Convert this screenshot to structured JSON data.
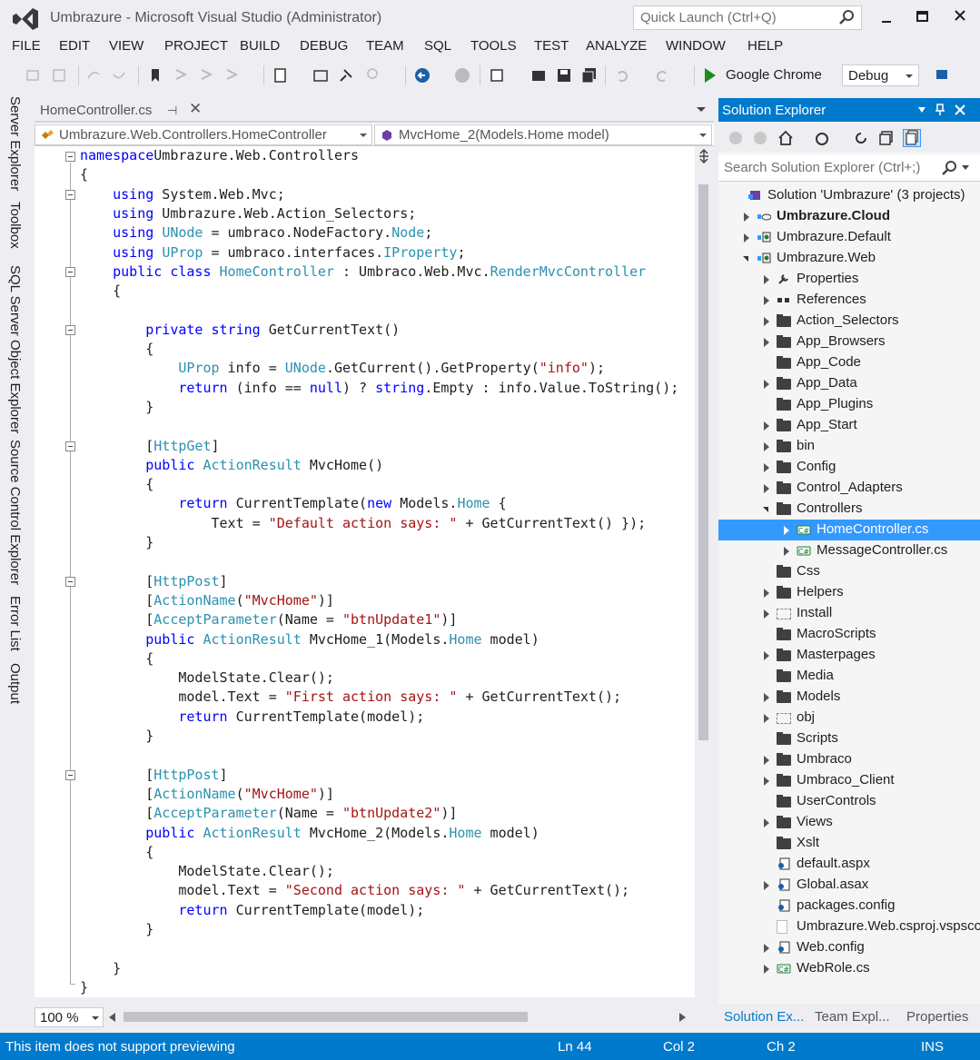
{
  "window": {
    "title": "Umbrazure - Microsoft Visual Studio (Administrator)",
    "quick_launch_placeholder": "Quick Launch (Ctrl+Q)"
  },
  "menu": [
    "FILE",
    "EDIT",
    "VIEW",
    "PROJECT",
    "BUILD",
    "DEBUG",
    "TEAM",
    "SQL",
    "TOOLS",
    "TEST",
    "ANALYZE",
    "WINDOW",
    "HELP"
  ],
  "toolbar": {
    "run_target": "Google Chrome",
    "configuration": "Debug"
  },
  "side_tabs": [
    "Server Explorer",
    "Toolbox",
    "SQL Server Object Explorer",
    "Source Control Explorer",
    "Error List",
    "Output"
  ],
  "document": {
    "tab_label": "HomeController.cs",
    "pin_glyph": "⊣",
    "close_glyph": "✕",
    "nav_type": "Umbrazure.Web.Controllers.HomeController",
    "nav_member": "MvcHome_2(Models.Home model)"
  },
  "code": [
    [
      [
        "kw",
        "namespace"
      ],
      [
        "",
        "Umbrazure.Web.Controllers"
      ]
    ],
    [
      [
        "",
        "{"
      ]
    ],
    [
      [
        "",
        "    "
      ],
      [
        "kw",
        "using"
      ],
      [
        "",
        " System.Web.Mvc;"
      ]
    ],
    [
      [
        "",
        "    "
      ],
      [
        "kw",
        "using"
      ],
      [
        "",
        " Umbrazure.Web.Action_Selectors;"
      ]
    ],
    [
      [
        "",
        "    "
      ],
      [
        "kw",
        "using"
      ],
      [
        "",
        " "
      ],
      [
        "ty",
        "UNode"
      ],
      [
        "",
        " = umbraco.NodeFactory."
      ],
      [
        "ty",
        "Node"
      ],
      [
        "",
        ";"
      ]
    ],
    [
      [
        "",
        "    "
      ],
      [
        "kw",
        "using"
      ],
      [
        "",
        " "
      ],
      [
        "ty",
        "UProp"
      ],
      [
        "",
        " = umbraco.interfaces."
      ],
      [
        "ty",
        "IProperty"
      ],
      [
        "",
        ";"
      ]
    ],
    [
      [
        "",
        "    "
      ],
      [
        "kw",
        "public"
      ],
      [
        "",
        " "
      ],
      [
        "kw",
        "class"
      ],
      [
        "",
        " "
      ],
      [
        "ty",
        "HomeController"
      ],
      [
        "",
        " : Umbraco.Web.Mvc."
      ],
      [
        "ty",
        "RenderMvcController"
      ]
    ],
    [
      [
        "",
        "    {"
      ]
    ],
    [
      [
        "",
        ""
      ]
    ],
    [
      [
        "",
        "        "
      ],
      [
        "kw",
        "private"
      ],
      [
        "",
        " "
      ],
      [
        "kw",
        "string"
      ],
      [
        "",
        " GetCurrentText()"
      ]
    ],
    [
      [
        "",
        "        {"
      ]
    ],
    [
      [
        "",
        "            "
      ],
      [
        "ty",
        "UProp"
      ],
      [
        "",
        " info = "
      ],
      [
        "ty",
        "UNode"
      ],
      [
        "",
        ".GetCurrent().GetProperty("
      ],
      [
        "st",
        "\"info\""
      ],
      [
        "",
        ");"
      ]
    ],
    [
      [
        "",
        "            "
      ],
      [
        "kw",
        "return"
      ],
      [
        "",
        " (info == "
      ],
      [
        "kw",
        "null"
      ],
      [
        "",
        ") ? "
      ],
      [
        "kw",
        "string"
      ],
      [
        "",
        ".Empty : info.Value.ToString();"
      ]
    ],
    [
      [
        "",
        "        }"
      ]
    ],
    [
      [
        "",
        ""
      ]
    ],
    [
      [
        "",
        "        ["
      ],
      [
        "ty",
        "HttpGet"
      ],
      [
        "",
        "]"
      ]
    ],
    [
      [
        "",
        "        "
      ],
      [
        "kw",
        "public"
      ],
      [
        "",
        " "
      ],
      [
        "ty",
        "ActionResult"
      ],
      [
        "",
        " MvcHome()"
      ]
    ],
    [
      [
        "",
        "        {"
      ]
    ],
    [
      [
        "",
        "            "
      ],
      [
        "kw",
        "return"
      ],
      [
        "",
        " CurrentTemplate("
      ],
      [
        "kw",
        "new"
      ],
      [
        "",
        " Models."
      ],
      [
        "ty",
        "Home"
      ],
      [
        "",
        " {"
      ]
    ],
    [
      [
        "",
        "                Text = "
      ],
      [
        "st",
        "\"Default action says: \""
      ],
      [
        "",
        " + GetCurrentText() });"
      ]
    ],
    [
      [
        "",
        "        }"
      ]
    ],
    [
      [
        "",
        ""
      ]
    ],
    [
      [
        "",
        "        ["
      ],
      [
        "ty",
        "HttpPost"
      ],
      [
        "",
        "]"
      ]
    ],
    [
      [
        "",
        "        ["
      ],
      [
        "ty",
        "ActionName"
      ],
      [
        "",
        "("
      ],
      [
        "st",
        "\"MvcHome\""
      ],
      [
        "",
        ")]"
      ]
    ],
    [
      [
        "",
        "        ["
      ],
      [
        "ty",
        "AcceptParameter"
      ],
      [
        "",
        "(Name = "
      ],
      [
        "st",
        "\"btnUpdate1\""
      ],
      [
        "",
        ")]"
      ]
    ],
    [
      [
        "",
        "        "
      ],
      [
        "kw",
        "public"
      ],
      [
        "",
        " "
      ],
      [
        "ty",
        "ActionResult"
      ],
      [
        "",
        " MvcHome_1(Models."
      ],
      [
        "ty",
        "Home"
      ],
      [
        "",
        " model)"
      ]
    ],
    [
      [
        "",
        "        {"
      ]
    ],
    [
      [
        "",
        "            ModelState.Clear();"
      ]
    ],
    [
      [
        "",
        "            model.Text = "
      ],
      [
        "st",
        "\"First action says: \""
      ],
      [
        "",
        " + GetCurrentText();"
      ]
    ],
    [
      [
        "",
        "            "
      ],
      [
        "kw",
        "return"
      ],
      [
        "",
        " CurrentTemplate(model);"
      ]
    ],
    [
      [
        "",
        "        }"
      ]
    ],
    [
      [
        "",
        ""
      ]
    ],
    [
      [
        "",
        "        ["
      ],
      [
        "ty",
        "HttpPost"
      ],
      [
        "",
        "]"
      ]
    ],
    [
      [
        "",
        "        ["
      ],
      [
        "ty",
        "ActionName"
      ],
      [
        "",
        "("
      ],
      [
        "st",
        "\"MvcHome\""
      ],
      [
        "",
        ")]"
      ]
    ],
    [
      [
        "",
        "        ["
      ],
      [
        "ty",
        "AcceptParameter"
      ],
      [
        "",
        "(Name = "
      ],
      [
        "st",
        "\"btnUpdate2\""
      ],
      [
        "",
        ")]"
      ]
    ],
    [
      [
        "",
        "        "
      ],
      [
        "kw",
        "public"
      ],
      [
        "",
        " "
      ],
      [
        "ty",
        "ActionResult"
      ],
      [
        "",
        " MvcHome_2(Models."
      ],
      [
        "ty",
        "Home"
      ],
      [
        "",
        " model)"
      ]
    ],
    [
      [
        "",
        "        {"
      ]
    ],
    [
      [
        "",
        "            ModelState.Clear();"
      ]
    ],
    [
      [
        "",
        "            model.Text = "
      ],
      [
        "st",
        "\"Second action says: \""
      ],
      [
        "",
        " + GetCurrentText();"
      ]
    ],
    [
      [
        "",
        "            "
      ],
      [
        "kw",
        "return"
      ],
      [
        "",
        " CurrentTemplate(model);"
      ]
    ],
    [
      [
        "",
        "        }"
      ]
    ],
    [
      [
        "",
        ""
      ]
    ],
    [
      [
        "",
        "    }"
      ]
    ],
    [
      [
        "",
        "}"
      ]
    ]
  ],
  "zoom": "100 %",
  "solution_explorer": {
    "title": "Solution Explorer",
    "search_placeholder": "Search Solution Explorer (Ctrl+;)",
    "tree": [
      {
        "label": "Solution 'Umbrazure' (3 projects)",
        "level": 0,
        "state": "none",
        "icon": "solution"
      },
      {
        "label": "Umbrazure.Cloud",
        "level": 1,
        "state": "collapsed",
        "icon": "cloud",
        "bold": true
      },
      {
        "label": "Umbrazure.Default",
        "level": 1,
        "state": "collapsed",
        "icon": "web"
      },
      {
        "label": "Umbrazure.Web",
        "level": 1,
        "state": "expanded",
        "icon": "web"
      },
      {
        "label": "Properties",
        "level": 2,
        "state": "collapsed",
        "icon": "wrench"
      },
      {
        "label": "References",
        "level": 2,
        "state": "collapsed",
        "icon": "refs"
      },
      {
        "label": "Action_Selectors",
        "level": 2,
        "state": "collapsed",
        "icon": "folder"
      },
      {
        "label": "App_Browsers",
        "level": 2,
        "state": "collapsed",
        "icon": "folder"
      },
      {
        "label": "App_Code",
        "level": 2,
        "state": "none",
        "icon": "folder"
      },
      {
        "label": "App_Data",
        "level": 2,
        "state": "collapsed",
        "icon": "folder"
      },
      {
        "label": "App_Plugins",
        "level": 2,
        "state": "none",
        "icon": "folder"
      },
      {
        "label": "App_Start",
        "level": 2,
        "state": "collapsed",
        "icon": "folder"
      },
      {
        "label": "bin",
        "level": 2,
        "state": "collapsed",
        "icon": "folder"
      },
      {
        "label": "Config",
        "level": 2,
        "state": "collapsed",
        "icon": "folder"
      },
      {
        "label": "Control_Adapters",
        "level": 2,
        "state": "collapsed",
        "icon": "folder"
      },
      {
        "label": "Controllers",
        "level": 2,
        "state": "expanded",
        "icon": "folder"
      },
      {
        "label": "HomeController.cs",
        "level": 3,
        "state": "collapsed",
        "icon": "cs",
        "selected": true
      },
      {
        "label": "MessageController.cs",
        "level": 3,
        "state": "collapsed",
        "icon": "cs"
      },
      {
        "label": "Css",
        "level": 2,
        "state": "none",
        "icon": "folder"
      },
      {
        "label": "Helpers",
        "level": 2,
        "state": "collapsed",
        "icon": "folder"
      },
      {
        "label": "Install",
        "level": 2,
        "state": "collapsed",
        "icon": "ghost-folder"
      },
      {
        "label": "MacroScripts",
        "level": 2,
        "state": "none",
        "icon": "folder"
      },
      {
        "label": "Masterpages",
        "level": 2,
        "state": "collapsed",
        "icon": "folder"
      },
      {
        "label": "Media",
        "level": 2,
        "state": "none",
        "icon": "folder"
      },
      {
        "label": "Models",
        "level": 2,
        "state": "collapsed",
        "icon": "folder"
      },
      {
        "label": "obj",
        "level": 2,
        "state": "collapsed",
        "icon": "ghost-folder"
      },
      {
        "label": "Scripts",
        "level": 2,
        "state": "none",
        "icon": "folder"
      },
      {
        "label": "Umbraco",
        "level": 2,
        "state": "collapsed",
        "icon": "folder"
      },
      {
        "label": "Umbraco_Client",
        "level": 2,
        "state": "collapsed",
        "icon": "folder"
      },
      {
        "label": "UserControls",
        "level": 2,
        "state": "none",
        "icon": "folder"
      },
      {
        "label": "Views",
        "level": 2,
        "state": "collapsed",
        "icon": "folder"
      },
      {
        "label": "Xslt",
        "level": 2,
        "state": "none",
        "icon": "folder"
      },
      {
        "label": "default.aspx",
        "level": 2,
        "state": "none",
        "icon": "page"
      },
      {
        "label": "Global.asax",
        "level": 2,
        "state": "collapsed",
        "icon": "page"
      },
      {
        "label": "packages.config",
        "level": 2,
        "state": "none",
        "icon": "page"
      },
      {
        "label": "Umbrazure.Web.csproj.vspscc",
        "level": 2,
        "state": "none",
        "icon": "ghost-file"
      },
      {
        "label": "Web.config",
        "level": 2,
        "state": "collapsed",
        "icon": "page"
      },
      {
        "label": "WebRole.cs",
        "level": 2,
        "state": "collapsed",
        "icon": "cs"
      }
    ],
    "bottom_tabs": [
      "Solution Ex...",
      "Team Expl...",
      "Properties"
    ]
  },
  "status": {
    "message": "This item does not support previewing",
    "line": "Ln 44",
    "col": "Col 2",
    "ch": "Ch 2",
    "mode": "INS"
  },
  "colors": {
    "accent": "#007acc",
    "keyword": "#0000ff",
    "type": "#2b91af",
    "string": "#a31515",
    "selection": "#3399ff"
  }
}
